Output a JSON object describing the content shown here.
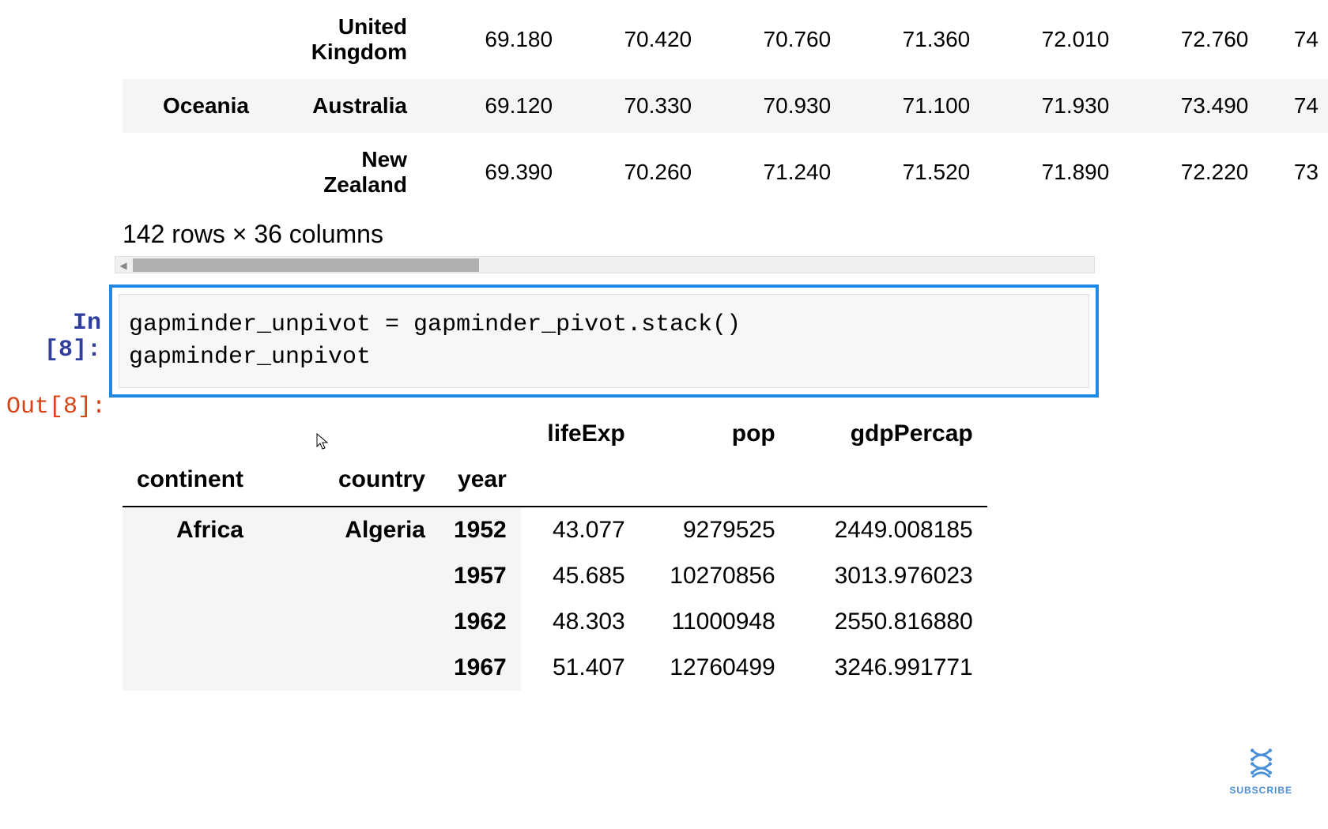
{
  "top_table": {
    "rows": [
      {
        "continent": "",
        "country": "United Kingdom",
        "values": [
          "69.180",
          "70.420",
          "70.760",
          "71.360",
          "72.010",
          "72.760",
          "74"
        ]
      },
      {
        "continent": "Oceania",
        "country": "Australia",
        "values": [
          "69.120",
          "70.330",
          "70.930",
          "71.100",
          "71.930",
          "73.490",
          "74"
        ]
      },
      {
        "continent": "",
        "country": "New Zealand",
        "values": [
          "69.390",
          "70.260",
          "71.240",
          "71.520",
          "71.890",
          "72.220",
          "73"
        ]
      }
    ]
  },
  "shape_label": "142 rows × 36 columns",
  "in_prompt": "In [8]:",
  "out_prompt": "Out[8]:",
  "code": "gapminder_unpivot = gapminder_pivot.stack()\ngapminder_unpivot",
  "output_table": {
    "col_headers": [
      "lifeExp",
      "pop",
      "gdpPercap"
    ],
    "index_headers": [
      "continent",
      "country",
      "year"
    ],
    "rows": [
      {
        "continent": "Africa",
        "country": "Algeria",
        "year": "1952",
        "lifeExp": "43.077",
        "pop": "9279525",
        "gdpPercap": "2449.008185"
      },
      {
        "continent": "",
        "country": "",
        "year": "1957",
        "lifeExp": "45.685",
        "pop": "10270856",
        "gdpPercap": "3013.976023"
      },
      {
        "continent": "",
        "country": "",
        "year": "1962",
        "lifeExp": "48.303",
        "pop": "11000948",
        "gdpPercap": "2550.816880"
      },
      {
        "continent": "",
        "country": "",
        "year": "1967",
        "lifeExp": "51.407",
        "pop": "12760499",
        "gdpPercap": "3246.991771"
      }
    ]
  },
  "subscribe": "SUBSCRIBE"
}
